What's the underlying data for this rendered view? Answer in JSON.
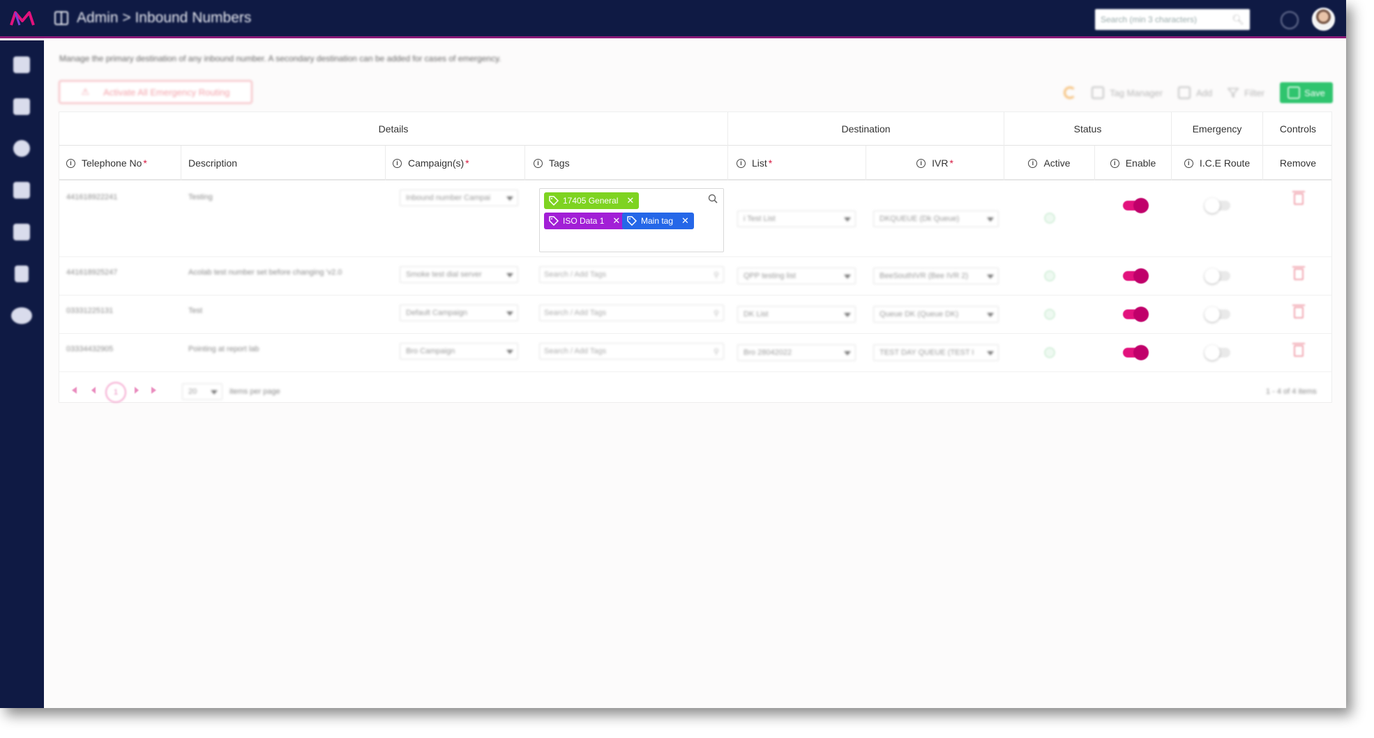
{
  "topbar": {
    "breadcrumb": "Admin > Inbound Numbers",
    "search_placeholder": "Search (min 3 characters)"
  },
  "sidebar": {
    "items": [
      "building-icon",
      "grid-list-icon",
      "dashboard-icon",
      "database-icon",
      "contacts-book-icon",
      "document-icon",
      "gears-icon"
    ]
  },
  "page": {
    "description": "Manage the primary destination of any inbound number. A secondary destination can be added for cases of emergency.",
    "emergency_button": "Activate All Emergency Routing"
  },
  "toolbar": {
    "tag_manager": "Tag Manager",
    "add": "Add",
    "filter": "Filter",
    "save": "Save"
  },
  "table": {
    "groups": [
      "Details",
      "Destination",
      "Status",
      "Emergency",
      "Controls"
    ],
    "headers": {
      "telephone": "Telephone No",
      "description": "Description",
      "campaigns": "Campaign(s)",
      "tags": "Tags",
      "list": "List",
      "ivr": "IVR",
      "active": "Active",
      "enable": "Enable",
      "ice_route": "I.C.E Route",
      "remove": "Remove"
    },
    "required_mark": "*",
    "tag_search_placeholder": "Search / Add Tags",
    "rows": [
      {
        "telephone": "441618922241",
        "description": "Testing",
        "campaign": "Inbound number Campai",
        "tags": [
          {
            "label": "17405 General",
            "color": "#7ed321"
          },
          {
            "label": "ISO Data 1",
            "color": "#a21fd6"
          },
          {
            "label": "Main tag",
            "color": "#2567e8"
          }
        ],
        "list": "i Test List",
        "ivr": "DKQUEUE (Dk Queue)",
        "enabled": true,
        "ice_route": false
      },
      {
        "telephone": "441618925247",
        "description": "Acolab test number set before changing 'v2.0",
        "campaign": "Smoke test dial server",
        "tags": [],
        "list": "QPP testing list",
        "ivr": "BeeSouthIVR (Bee IVR 2)",
        "enabled": true,
        "ice_route": false
      },
      {
        "telephone": "03331225131",
        "description": "Test",
        "campaign": "Default Campaign",
        "tags": [],
        "list": "DK List",
        "ivr": "Queue DK (Queue DK)",
        "enabled": true,
        "ice_route": false
      },
      {
        "telephone": "03334432905",
        "description": "Pointing at report lab",
        "campaign": "Bro Campaign",
        "tags": [],
        "list": "Bro 28042022",
        "ivr": "TEST DAY QUEUE (TEST I",
        "enabled": true,
        "ice_route": false
      }
    ]
  },
  "pager": {
    "current_page": "1",
    "page_size": "20",
    "items_per_page": "items per page",
    "summary": "1 - 4 of 4 items"
  },
  "colors": {
    "navy": "#0f1a44",
    "accent": "#e2127d",
    "save_green": "#2fc46e"
  }
}
